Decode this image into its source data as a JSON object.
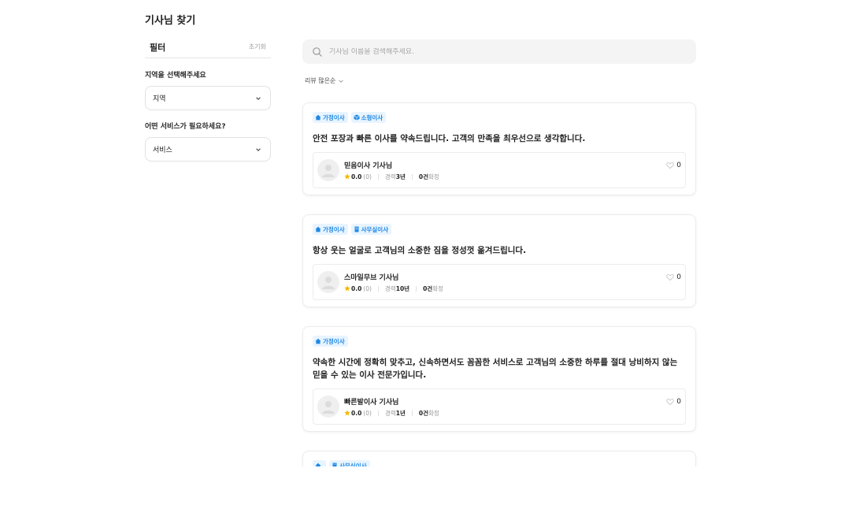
{
  "page": {
    "title": "기사님 찾기"
  },
  "sidebar": {
    "filter_title": "필터",
    "reset_label": "초기화",
    "region": {
      "label": "지역을 선택해주세요",
      "value": "지역"
    },
    "service": {
      "label": "어떤 서비스가 필요하세요?",
      "value": "서비스"
    }
  },
  "search": {
    "placeholder": "기사님 이름을 검색해주세요."
  },
  "sort": {
    "label": "리뷰 많은순"
  },
  "colors": {
    "accent": "#1e88e5",
    "tag_bg": "#e8f4ff",
    "star": "#f5b800"
  },
  "cards": [
    {
      "tags": [
        {
          "label": "가정이사",
          "icon": "house-icon"
        },
        {
          "label": "소형이사",
          "icon": "box-icon"
        }
      ],
      "description": "안전 포장과 빠른 이사를 약속드립니다. 고객의 만족을 최우선으로 생각합니다.",
      "driver": {
        "name": "믿음이사 기사님",
        "rating": "0.0",
        "reviews": "(0)",
        "career_label": "경력",
        "career": "3년",
        "count": "0건",
        "count_label": "확정"
      },
      "likes": "0"
    },
    {
      "tags": [
        {
          "label": "가정이사",
          "icon": "house-icon"
        },
        {
          "label": "사무실이사",
          "icon": "building-icon"
        }
      ],
      "description": "항상 웃는 얼굴로 고객님의 소중한 짐을 정성껏 옮겨드립니다.",
      "driver": {
        "name": "스마일무브 기사님",
        "rating": "0.0",
        "reviews": "(0)",
        "career_label": "경력",
        "career": "10년",
        "count": "0건",
        "count_label": "확정"
      },
      "likes": "0"
    },
    {
      "tags": [
        {
          "label": "가정이사",
          "icon": "house-icon"
        }
      ],
      "description": "약속한 시간에 정확히 맞추고, 신속하면서도 꼼꼼한 서비스로 고객님의 소중한 하루를 절대 낭비하지 않는 믿을 수 있는 이사 전문가입니다.",
      "driver": {
        "name": "빠른발이사 기사님",
        "rating": "0.0",
        "reviews": "(0)",
        "career_label": "경력",
        "career": "1년",
        "count": "0건",
        "count_label": "확정"
      },
      "likes": "0"
    },
    {
      "tags": [
        {
          "label": "사무실이사",
          "icon": "building-icon"
        }
      ]
    }
  ]
}
